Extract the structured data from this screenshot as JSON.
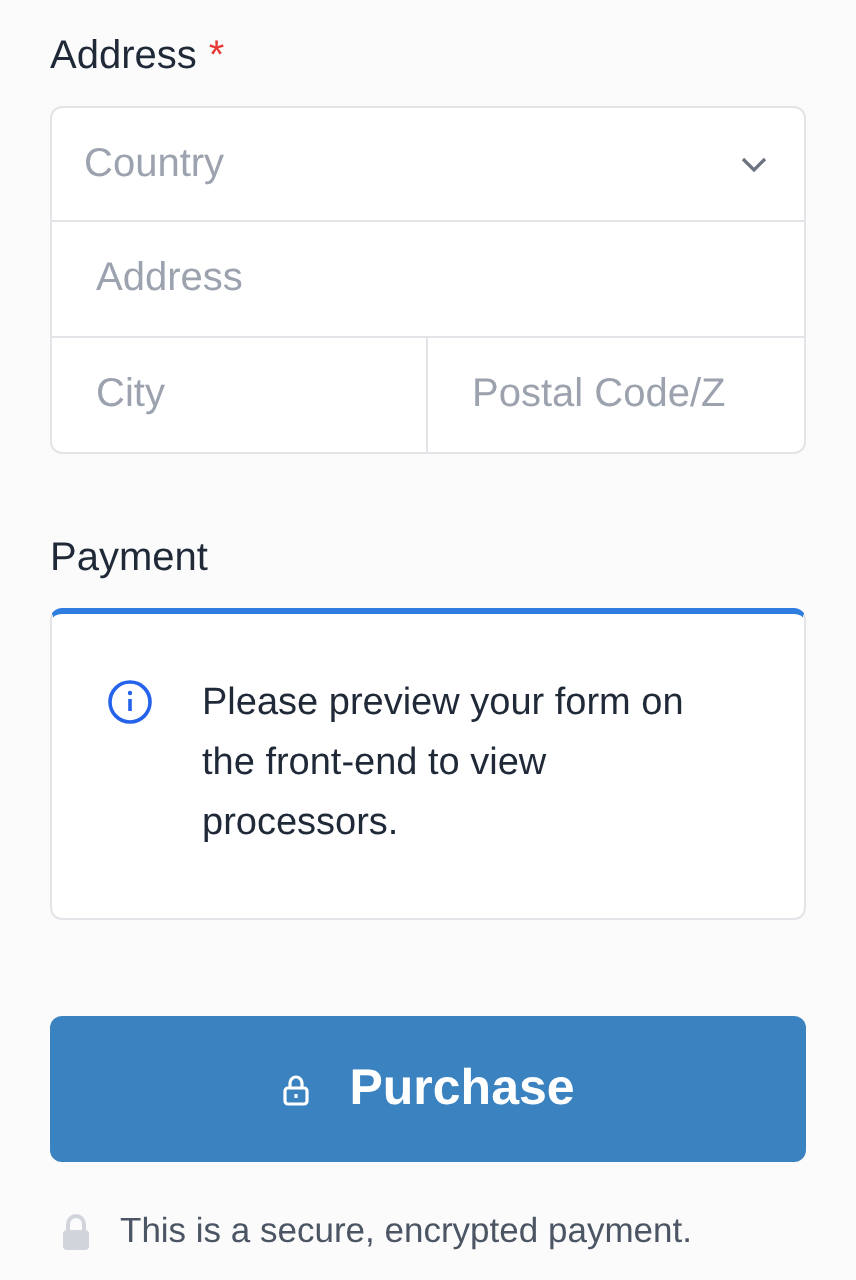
{
  "address": {
    "label": "Address",
    "required_mark": "*",
    "country": {
      "placeholder": "Country"
    },
    "street": {
      "placeholder": "Address"
    },
    "city": {
      "placeholder": "City"
    },
    "postal_code": {
      "placeholder": "Postal Code/Z"
    }
  },
  "payment": {
    "label": "Payment",
    "notice": "Please preview your form on the front-end to view processors."
  },
  "purchase_button": {
    "label": "Purchase"
  },
  "secure_note": "This is a secure, encrypted payment."
}
